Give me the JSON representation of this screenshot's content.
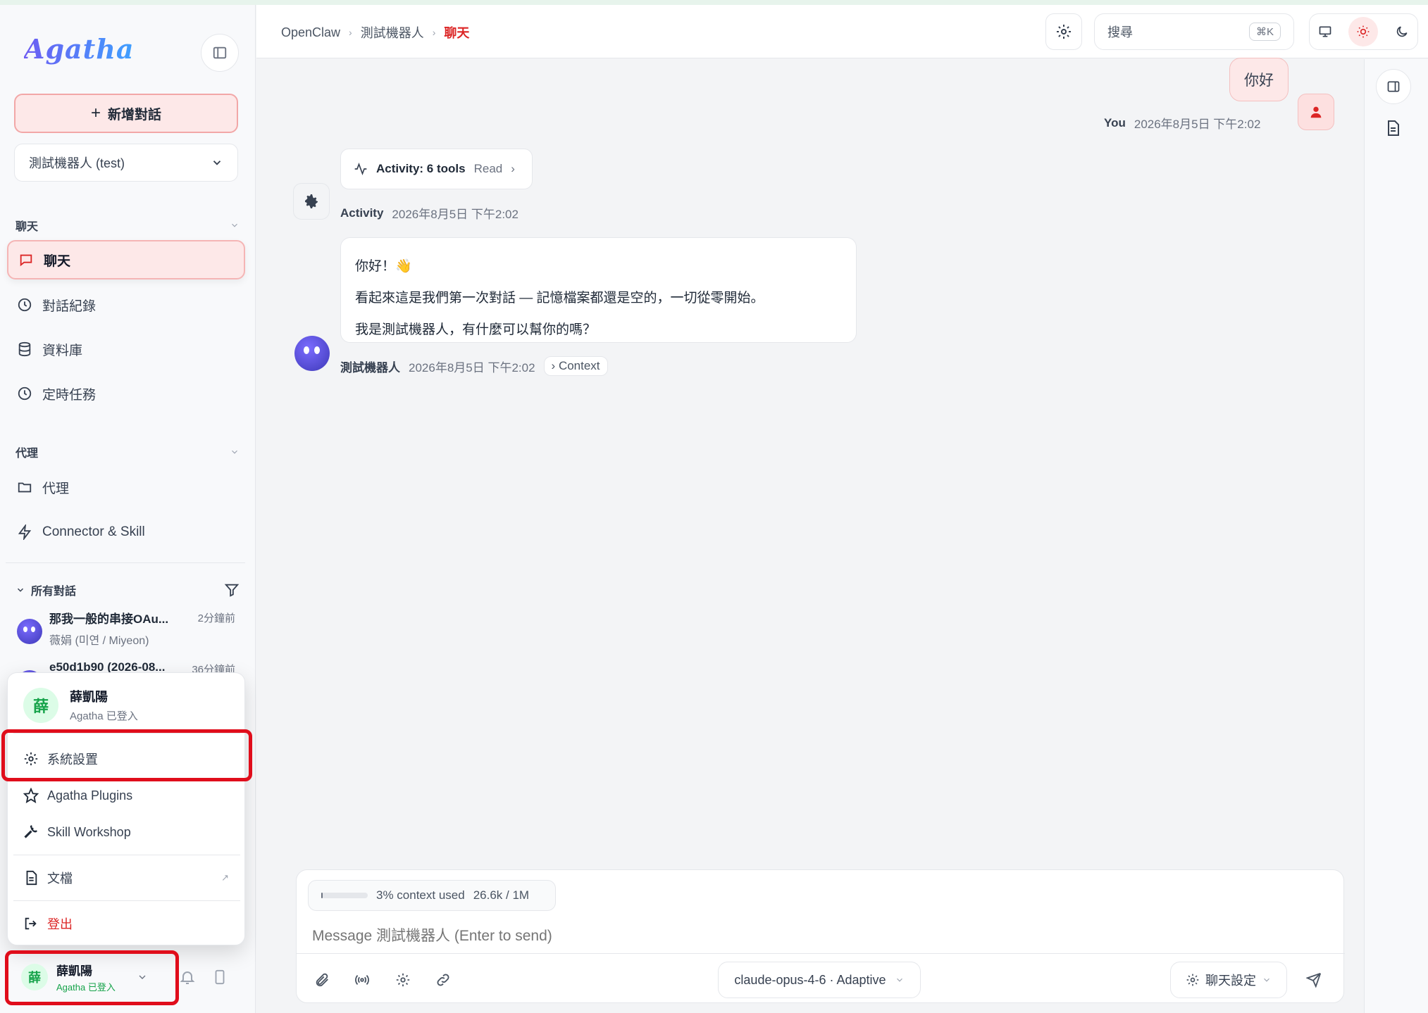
{
  "app": {
    "logo_text": "Agatha"
  },
  "sidebar": {
    "new_chat_label": "新增對話",
    "bot_selector_value": "測試機器人 (test)",
    "section_chat": "聊天",
    "nav_chat": [
      {
        "label": "聊天",
        "icon": "message-icon",
        "active": true
      },
      {
        "label": "對話紀錄",
        "icon": "clock-icon"
      },
      {
        "label": "資料庫",
        "icon": "database-icon"
      },
      {
        "label": "定時任務",
        "icon": "clock-icon"
      }
    ],
    "section_agent": "代理",
    "nav_agent": [
      {
        "label": "代理",
        "icon": "folder-icon"
      },
      {
        "label": "Connector & Skill",
        "icon": "bolt-icon"
      }
    ],
    "all_conversations_label": "所有對話",
    "conversations": [
      {
        "title": "那我一般的串接OAu...",
        "subtitle": "薇娟 (미연 / Miyeon)",
        "time": "2分鐘前"
      },
      {
        "title": "e50d1b90 (2026-08...",
        "subtitle": "",
        "time": "36分鐘前"
      }
    ]
  },
  "user_menu": {
    "avatar_char": "薛",
    "name": "薛凱陽",
    "status": "Agatha 已登入",
    "items": [
      {
        "label": "系統設置",
        "icon": "gear-icon"
      },
      {
        "label": "Agatha Plugins",
        "icon": "star-icon"
      },
      {
        "label": "Skill Workshop",
        "icon": "wrench-icon"
      },
      {
        "label": "文檔",
        "icon": "document-icon"
      },
      {
        "label": "登出",
        "icon": "logout-icon"
      }
    ]
  },
  "user_bar": {
    "avatar_char": "薛",
    "name": "薛凱陽",
    "status": "Agatha 已登入"
  },
  "header": {
    "breadcrumb": [
      "OpenClaw",
      "測試機器人",
      "聊天"
    ],
    "search_placeholder": "搜尋",
    "search_shortcut": "⌘K"
  },
  "messages": {
    "user_text": "你好",
    "user_name": "You",
    "user_time": "2026年8月5日 下午2:02",
    "activity_label": "Activity: 6 tools",
    "activity_tool": "Read",
    "activity_name": "Activity",
    "activity_time": "2026年8月5日 下午2:02",
    "reply_lines": [
      "你好！👋",
      "看起來這是我們第一次對話 — 記憶檔案都還是空的，一切從零開始。",
      "我是測試機器人，有什麼可以幫你的嗎？"
    ],
    "bot_name": "測試機器人",
    "bot_time": "2026年8月5日 下午2:02",
    "context_label": "Context"
  },
  "composer": {
    "context_percent": 3,
    "context_used_label": "3% context used",
    "context_tokens": "26.6k / 1M",
    "placeholder": "Message 測試機器人 (Enter to send)",
    "model_label": "claude-opus-4-6 · Adaptive",
    "settings_label": "聊天設定"
  },
  "colors": {
    "accent": "#dc2626",
    "accent_bg": "#fde8e8",
    "highlight_box": "#e00d1b",
    "success": "#16a34a"
  }
}
